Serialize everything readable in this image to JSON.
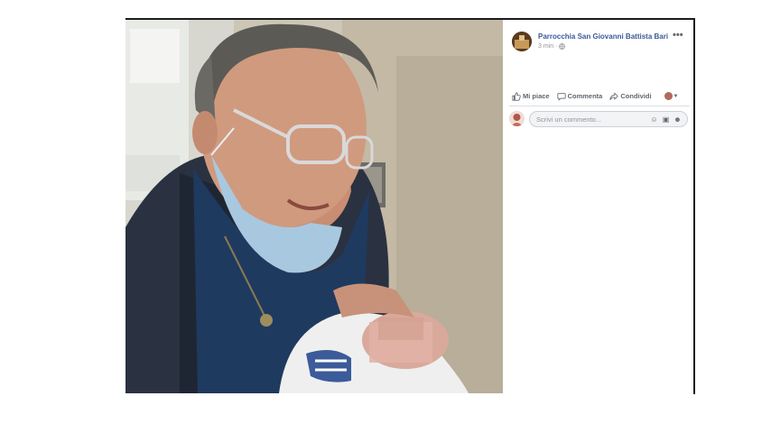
{
  "post": {
    "page_name": "Parrocchia San Giovanni Battista Bari",
    "time": "3 min",
    "more_icon": "more-icon",
    "privacy_icon": "globe-icon"
  },
  "actions": {
    "like_label": "Mi piace",
    "comment_label": "Commenta",
    "share_label": "Condividi"
  },
  "comment": {
    "placeholder": "Scrivi un commento..."
  },
  "colors": {
    "link_blue": "#3b5998",
    "meta_gray": "#90949c",
    "action_gray": "#606770",
    "input_bg": "#f2f3f5",
    "divider": "#dadde1"
  }
}
